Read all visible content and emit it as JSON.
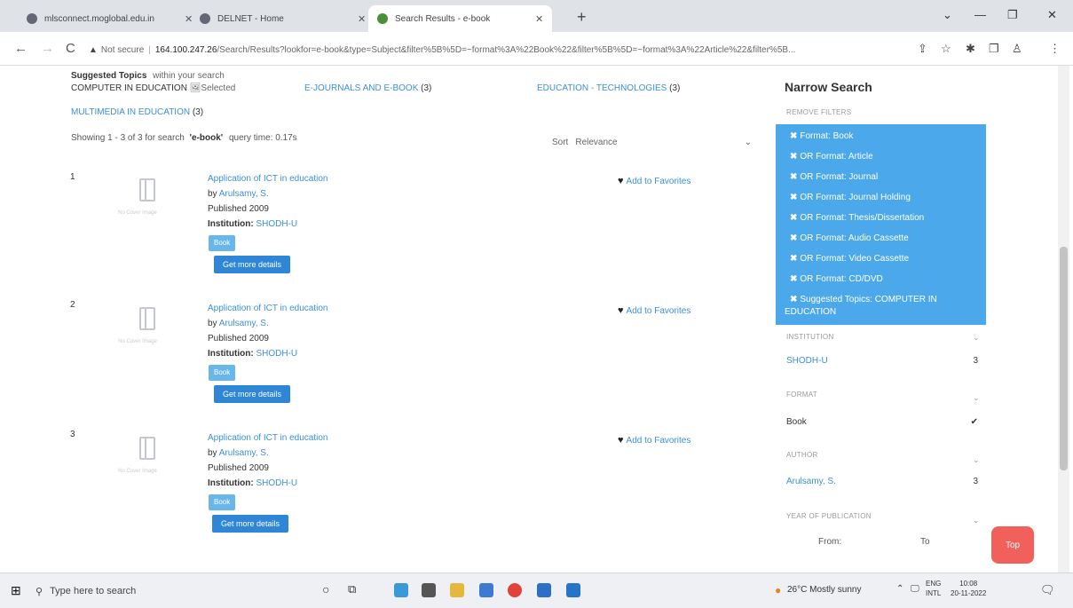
{
  "browser": {
    "tabs": [
      {
        "title": "mlsconnect.moglobal.edu.in",
        "active": false
      },
      {
        "title": "DELNET - Home",
        "active": false
      },
      {
        "title": "Search Results - e-book",
        "active": true
      }
    ],
    "new_tab": "+",
    "minimize": "—",
    "restore": "❐",
    "close": "✕",
    "tab_menu": "⌄",
    "back": "←",
    "forward": "→",
    "reload": "C",
    "not_secure": "Not secure",
    "host": "164.100.247.26",
    "url_path": "/Search/Results?lookfor=e-book&type=Subject&filter%5B%5D=~format%3A%22Book%22&filter%5B%5D=~format%3A%22Article%22&filter%5B..."
  },
  "page": {
    "suggested_label": "Suggested Topics",
    "suggested_suffix": "within your search",
    "topics": [
      {
        "label": "COMPUTER IN EDUCATION",
        "note": "Selected"
      },
      {
        "label": "E-JOURNALS AND E-BOOK",
        "count": "(3)"
      },
      {
        "label": "EDUCATION - TECHNOLOGIES",
        "count": "(3)"
      },
      {
        "label": "MULTIMEDIA IN EDUCATION",
        "count": "(3)"
      }
    ],
    "showing_prefix": "Showing 1 - 3 of 3 for search",
    "search_term": "'e-book'",
    "query_time": "query time: 0.17s",
    "sort_label": "Sort",
    "sort_value": "Relevance",
    "results": [
      {
        "num": "1",
        "title": "Application of ICT in education",
        "by": "by",
        "author": "Arulsamy, S.",
        "published": "Published 2009",
        "institution_label": "Institution:",
        "institution": "SHODH-U",
        "format": "Book",
        "details": "Get more details",
        "favorite": "Add to Favorites",
        "no_cover": "No Cover Image"
      },
      {
        "num": "2",
        "title": "Application of ICT in education",
        "by": "by",
        "author": "Arulsamy, S.",
        "published": "Published 2009",
        "institution_label": "Institution:",
        "institution": "SHODH-U",
        "format": "Book",
        "details": "Get more details",
        "favorite": "Add to Favorites",
        "no_cover": "No Cover Image"
      },
      {
        "num": "3",
        "title": "Application of ICT in education",
        "by": "by",
        "author": "Arulsamy, S.",
        "published": "Published 2009",
        "institution_label": "Institution:",
        "institution": "SHODH-U",
        "format": "Book",
        "details": "Get more details",
        "favorite": "Add to Favorites",
        "no_cover": "No Cover Image"
      }
    ]
  },
  "sidebar": {
    "title": "Narrow Search",
    "remove_filters": "REMOVE FILTERS",
    "filters": [
      "Format: Book",
      "OR Format: Article",
      "OR Format: Journal",
      "OR Format: Journal Holding",
      "OR Format: Thesis/Dissertation",
      "OR Format: Audio Cassette",
      "OR Format: Video Cassette",
      "OR Format: CD/DVD",
      "Suggested Topics: COMPUTER IN",
      "EDUCATION"
    ],
    "institution_h": "INSTITUTION",
    "institution_item": "SHODH-U",
    "institution_count": "3",
    "format_h": "FORMAT",
    "format_item": "Book",
    "author_h": "AUTHOR",
    "author_item": "Arulsamy, S.",
    "author_count": "3",
    "year_h": "YEAR OF PUBLICATION",
    "from_label": "From:",
    "to_label": "To",
    "top_button": "Top"
  },
  "taskbar": {
    "search_placeholder": "Type here to search",
    "weather": "26°C  Mostly sunny",
    "lang1": "ENG",
    "lang2": "INTL",
    "time": "10:08",
    "date": "20-11-2022"
  }
}
